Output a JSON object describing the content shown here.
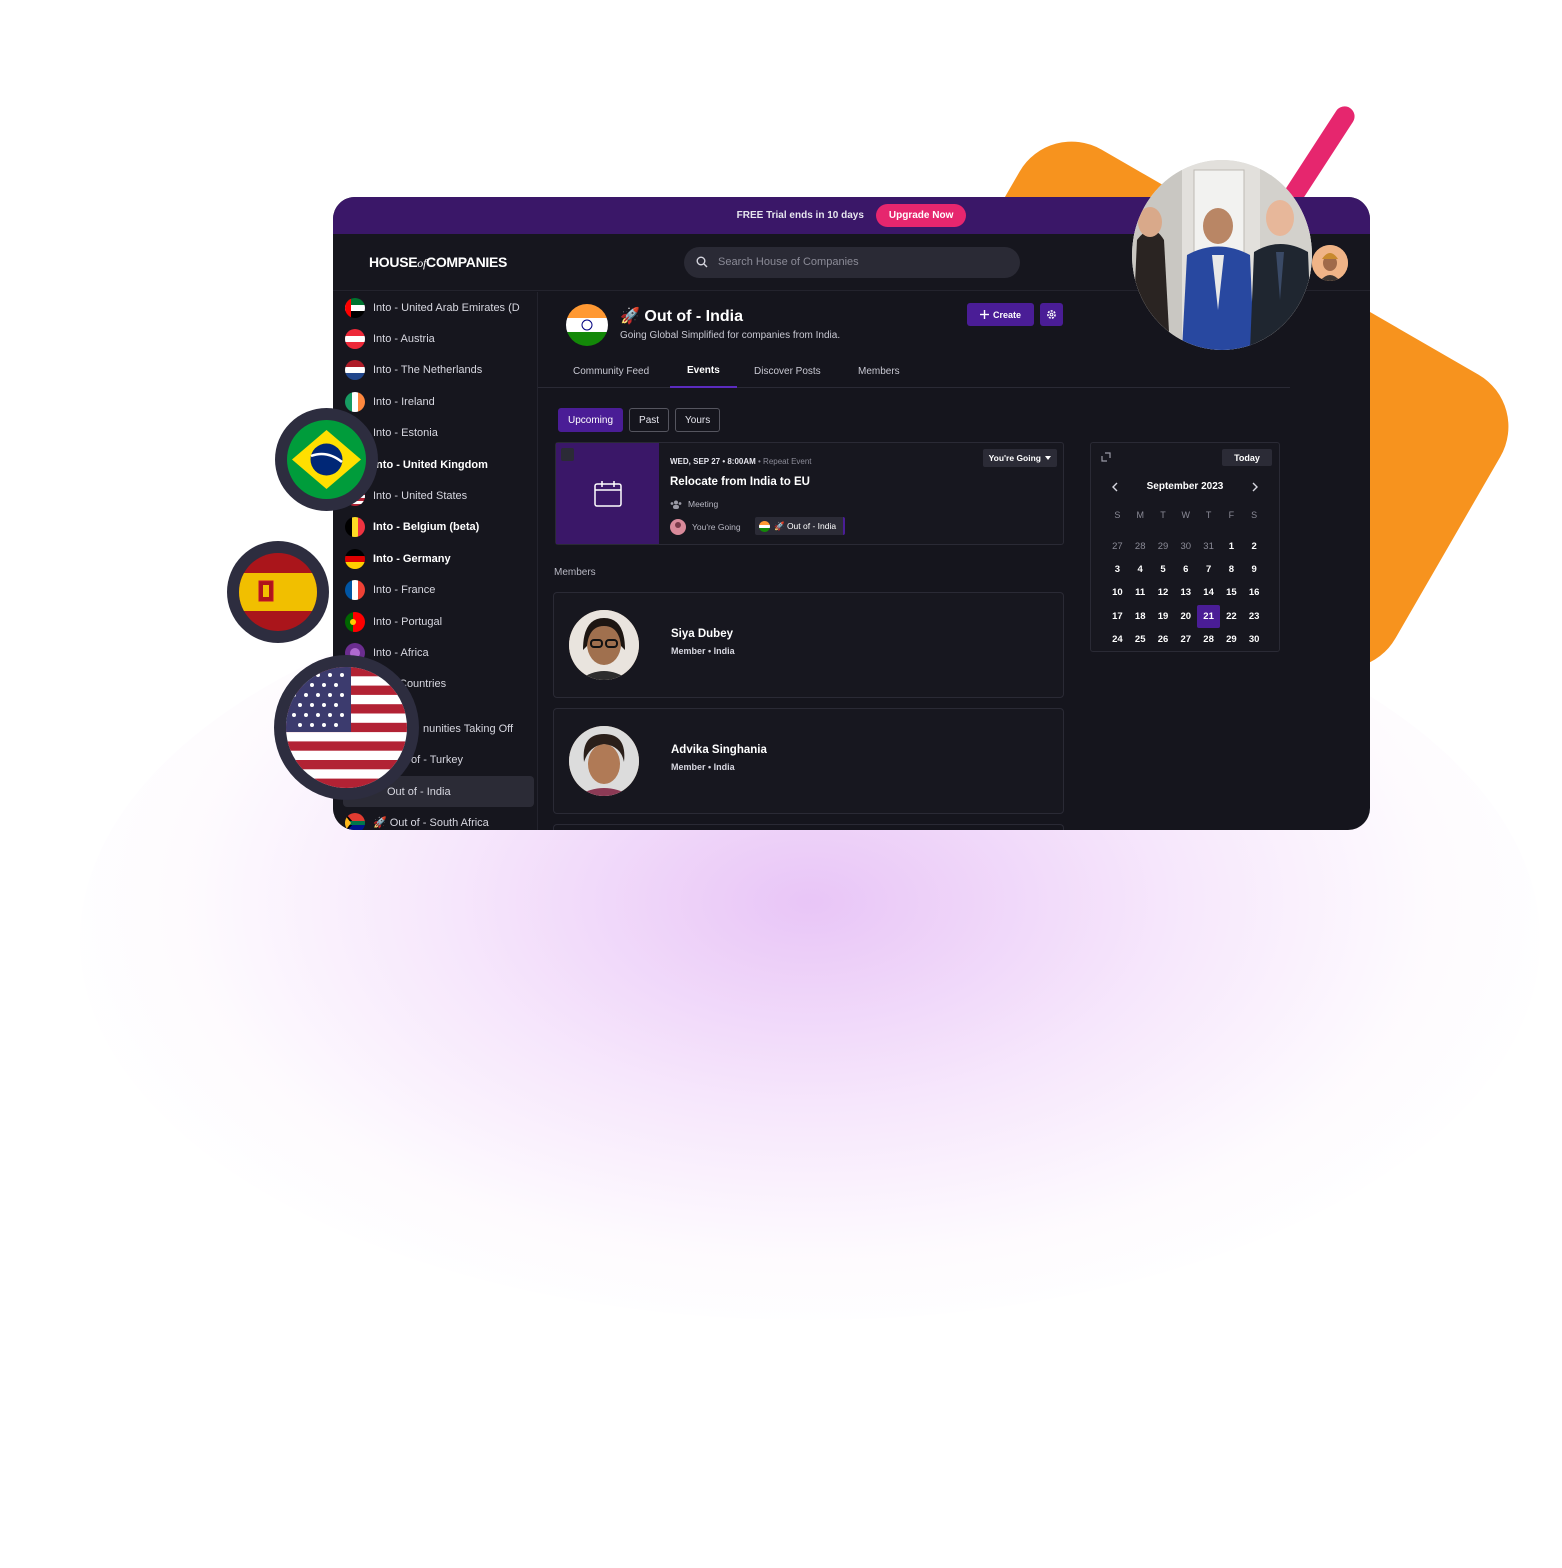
{
  "trial_banner": {
    "text": "FREE Trial ends in 10 days",
    "upgrade_label": "Upgrade Now"
  },
  "header": {
    "logo": {
      "part1": "HOUSE",
      "part2": "of",
      "part3": "COMPANIES"
    },
    "search_placeholder": "Search House of Companies"
  },
  "sidebar": {
    "items": [
      {
        "label": "Into - United Arab Emirates (D",
        "flag": "uae"
      },
      {
        "label": "Into - Austria",
        "flag": "austria"
      },
      {
        "label": "Into - The Netherlands",
        "flag": "netherlands"
      },
      {
        "label": "Into - Ireland",
        "flag": "ireland"
      },
      {
        "label": "Into - Estonia",
        "flag": "estonia"
      },
      {
        "label": "Into - United Kingdom",
        "flag": "uk"
      },
      {
        "label": "Into - United States",
        "flag": "usa"
      },
      {
        "label": "Into - Belgium (beta)",
        "flag": "belgium"
      },
      {
        "label": "Into - Germany",
        "flag": "germany"
      },
      {
        "label": "Into - France",
        "flag": "france"
      },
      {
        "label": "Into - Portugal",
        "flag": "portugal"
      },
      {
        "label": "Into - Africa",
        "flag": "africa"
      },
      {
        "label": "Countries",
        "flag": ""
      },
      {
        "label": "nunities Taking Off",
        "flag": ""
      },
      {
        "label": "of - Turkey",
        "flag": ""
      },
      {
        "label": "Out of - India",
        "flag": ""
      },
      {
        "label": "🚀 Out of - South Africa",
        "flag": "south-africa"
      }
    ]
  },
  "community": {
    "title": "🚀 Out of - India",
    "subtitle": "Going Global Simplified for companies from India.",
    "create_label": "Create",
    "tabs": [
      "Community Feed",
      "Events",
      "Discover Posts",
      "Members"
    ],
    "active_tab": "Events"
  },
  "filters": {
    "items": [
      "Upcoming",
      "Past",
      "Yours"
    ],
    "active": "Upcoming"
  },
  "event": {
    "date": "WED, SEP 27 • 8:00AM",
    "repeat": "• Repeat Event",
    "title": "Relocate from India to EU",
    "type": "Meeting",
    "going": "You're Going",
    "community_tag": "🚀 Out of - India",
    "rsvp_label": "You're Going"
  },
  "members": {
    "label": "Members",
    "items": [
      {
        "name": "Siya Dubey",
        "role": "Member",
        "country": "India"
      },
      {
        "name": "Advika Singhania",
        "role": "Member",
        "country": "India"
      }
    ]
  },
  "calendar": {
    "today_label": "Today",
    "month": "September 2023",
    "dow": [
      "S",
      "M",
      "T",
      "W",
      "T",
      "F",
      "S"
    ],
    "weeks": [
      [
        "27",
        "28",
        "29",
        "30",
        "31",
        "1",
        "2"
      ],
      [
        "3",
        "4",
        "5",
        "6",
        "7",
        "8",
        "9"
      ],
      [
        "10",
        "11",
        "12",
        "13",
        "14",
        "15",
        "16"
      ],
      [
        "17",
        "18",
        "19",
        "20",
        "21",
        "22",
        "23"
      ],
      [
        "24",
        "25",
        "26",
        "27",
        "28",
        "29",
        "30"
      ]
    ],
    "selected": "21",
    "colors": {
      "accent": "#4a1d96",
      "banner": "#3a1768",
      "upgrade": "#e6266e",
      "orange": "#f7931e"
    }
  }
}
